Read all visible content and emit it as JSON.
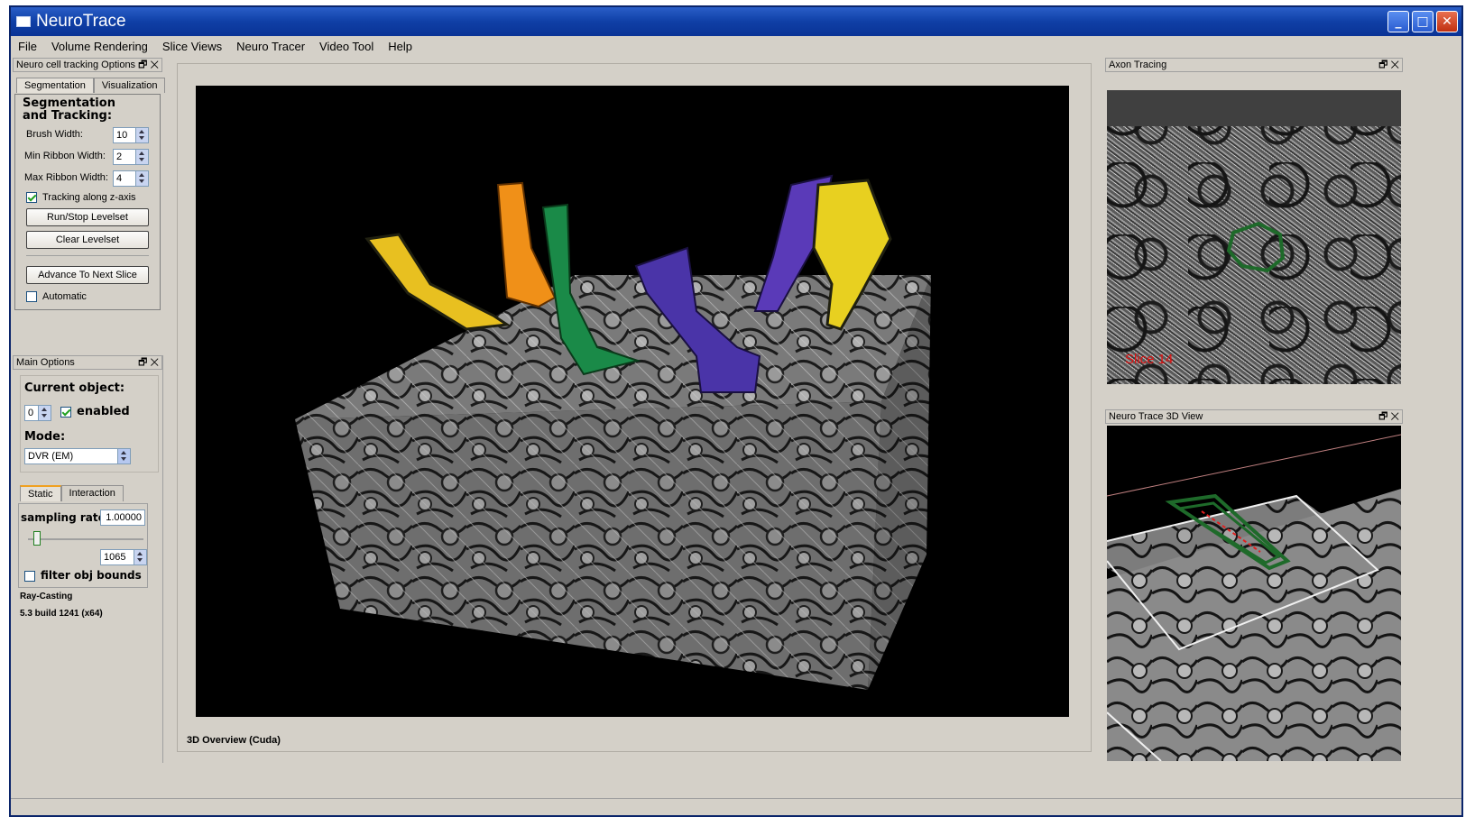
{
  "window": {
    "title": "NeuroTrace"
  },
  "menu": [
    "File",
    "Volume Rendering",
    "Slice Views",
    "Neuro Tracer",
    "Video Tool",
    "Help"
  ],
  "tracking_dock": {
    "title": "Neuro cell tracking Options",
    "tabs": [
      "Segmentation",
      "Visualization"
    ],
    "section_title": "Segmentation and Tracking:",
    "brush_width": {
      "label": "Brush Width:",
      "value": "10"
    },
    "min_ribbon": {
      "label": "Min Ribbon Width:",
      "value": "2"
    },
    "max_ribbon": {
      "label": "Max Ribbon Width:",
      "value": "4"
    },
    "tracking_z": {
      "label": "Tracking along z-axis",
      "checked": true
    },
    "run_button": "Run/Stop Levelset",
    "clear_button": "Clear Levelset",
    "advance_button": "Advance To Next Slice",
    "automatic": {
      "label": "Automatic",
      "checked": false
    }
  },
  "main_dock": {
    "title": "Main Options",
    "current_object_label": "Current object:",
    "current_object_value": "0",
    "enabled_label": "enabled",
    "mode_label": "Mode:",
    "mode_value": "DVR (EM)",
    "tabs": [
      "Static",
      "Interaction"
    ],
    "sampling_label": "sampling rate",
    "sampling_value": "1.00000",
    "slider_value": "1065",
    "filter_label": "filter obj bounds",
    "renderer": "Ray-Casting",
    "build": "5.3 build 1241 (x64)"
  },
  "center_view": {
    "caption": "3D Overview (Cuda)"
  },
  "axon_dock": {
    "title": "Axon Tracing",
    "slice_label": "Slice 14"
  },
  "trace3d_dock": {
    "title": "Neuro Trace 3D View"
  },
  "colors": {
    "title_bar": "#0f3fa6",
    "panel_bg": "#d4d0c8",
    "axon_outline": "#1e6a2a",
    "slice_text": "#e01010"
  }
}
